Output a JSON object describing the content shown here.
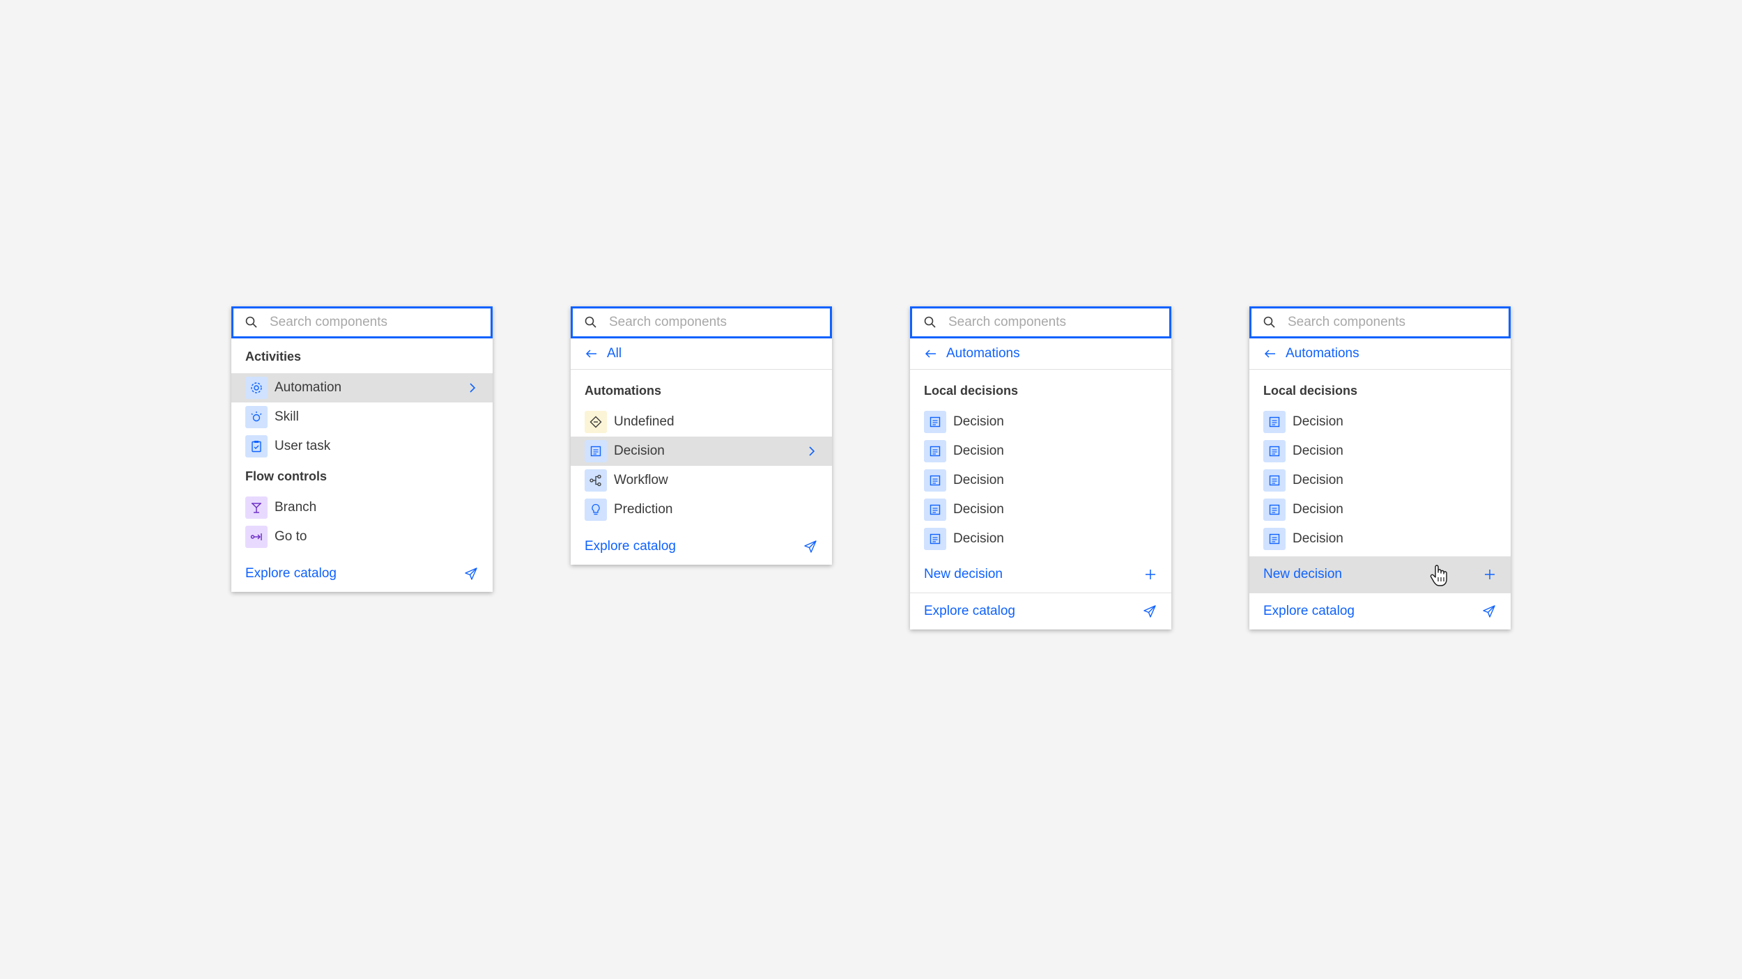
{
  "search": {
    "placeholder": "Search components"
  },
  "panel1": {
    "section1_title": "Activities",
    "items1": [
      {
        "label": "Automation",
        "icon": "automation-icon"
      },
      {
        "label": "Skill",
        "icon": "skill-icon"
      },
      {
        "label": "User task",
        "icon": "user-task-icon"
      }
    ],
    "section2_title": "Flow controls",
    "items2": [
      {
        "label": "Branch",
        "icon": "branch-icon"
      },
      {
        "label": "Go to",
        "icon": "go-to-icon"
      }
    ],
    "footer": "Explore catalog"
  },
  "panel2": {
    "back": "All",
    "section_title": "Automations",
    "items": [
      {
        "label": "Undefined",
        "icon": "undefined-icon"
      },
      {
        "label": "Decision",
        "icon": "decision-icon"
      },
      {
        "label": "Workflow",
        "icon": "workflow-icon"
      },
      {
        "label": "Prediction",
        "icon": "prediction-icon"
      }
    ],
    "footer": "Explore catalog"
  },
  "panel3": {
    "back": "Automations",
    "section_title": "Local decisions",
    "items": [
      "Decision",
      "Decision",
      "Decision",
      "Decision",
      "Decision"
    ],
    "new_label": "New decision",
    "footer": "Explore catalog"
  },
  "panel4": {
    "back": "Automations",
    "section_title": "Local decisions",
    "items": [
      "Decision",
      "Decision",
      "Decision",
      "Decision",
      "Decision"
    ],
    "new_label": "New decision",
    "footer": "Explore catalog"
  },
  "colors": {
    "accent": "#0f62fe",
    "background": "#f4f4f4",
    "hover": "#e0e0e0",
    "icon_blue_bg": "#d0e2ff",
    "icon_yellow_bg": "#fcf4d6",
    "icon_purple_bg": "#e8daff"
  }
}
